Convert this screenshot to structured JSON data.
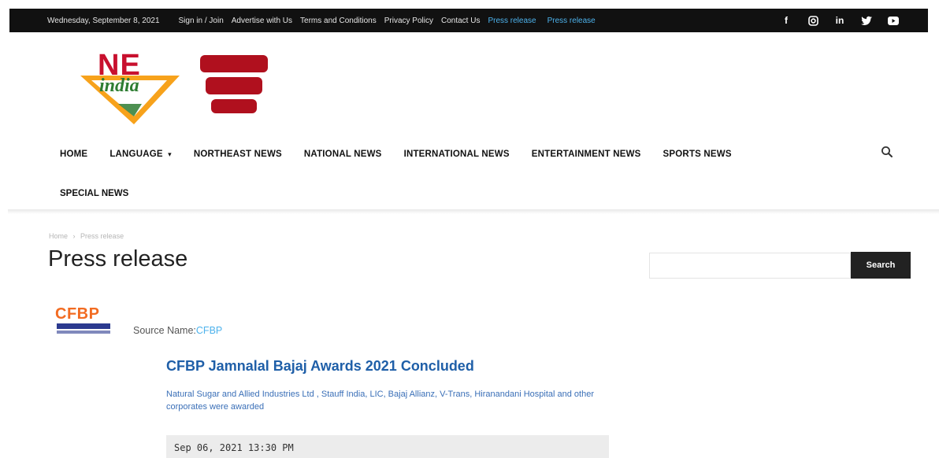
{
  "topbar": {
    "date": "Wednesday, September 8, 2021",
    "links": [
      "Sign in / Join",
      "Advertise with Us",
      "Terms and Conditions",
      "Privacy Policy",
      "Contact Us"
    ],
    "accent_links": [
      "Press release",
      "Press release"
    ],
    "social_icons": [
      "facebook-icon",
      "instagram-icon",
      "linkedin-icon",
      "twitter-icon",
      "youtube-icon"
    ]
  },
  "logo": {
    "top": "NE",
    "bottom": "india"
  },
  "nav": {
    "items": [
      "HOME",
      "LANGUAGE",
      "NORTHEAST NEWS",
      "NATIONAL NEWS",
      "INTERNATIONAL NEWS",
      "ENTERTAINMENT NEWS",
      "SPORTS NEWS"
    ],
    "second_row": "SPECIAL NEWS",
    "dropdown_glyph": "▾"
  },
  "breadcrumb": {
    "home": "Home",
    "separator": "›",
    "current": "Press release"
  },
  "page": {
    "title": "Press release"
  },
  "search": {
    "button_label": "Search",
    "placeholder": ""
  },
  "press_item": {
    "logo_text": "CFBP",
    "source_label": "Source Name:",
    "source_value": "CFBP",
    "title": "CFBP Jamnalal Bajaj Awards 2021 Concluded",
    "description": "Natural Sugar and Allied Industries Ltd , Stauff India, LIC, Bajaj Allianz, V-Trans, Hiranandani Hospital and other corporates were awarded",
    "date": "Sep 06, 2021 13:30 PM"
  },
  "colors": {
    "topbar_bg": "#111111",
    "accent": "#4db2ec",
    "title_blue": "#1f5fa8",
    "logo_red": "#c8102e",
    "logo_green": "#2e7d32",
    "cfbp_orange": "#f26b21"
  }
}
